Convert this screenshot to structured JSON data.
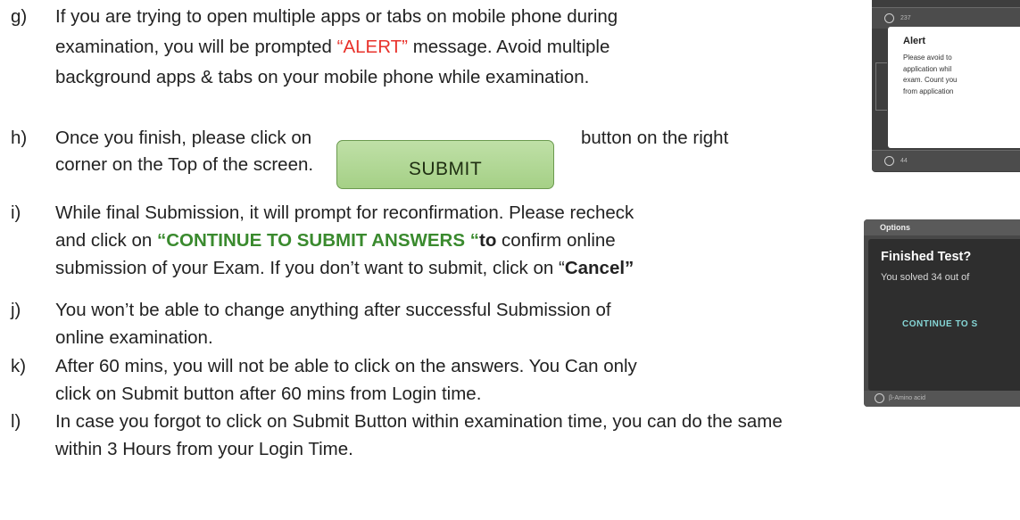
{
  "instructions": [
    {
      "letter": "g)",
      "lines": [
        [
          "If you are trying to open multiple apps or tabs on mobile phone during"
        ],
        [
          "examination, you will be prompted ",
          {
            "alert": "“ALERT”"
          },
          " message. Avoid multiple"
        ],
        [
          "background apps & tabs on your mobile phone while examination."
        ]
      ]
    },
    {
      "letter": "h)",
      "lines": [
        [
          "Once you finish, please click on"
        ],
        [
          "corner on the Top of the screen."
        ]
      ],
      "after_button": "button on the right"
    },
    {
      "letter": "i)",
      "lines": [
        [
          "While final Submission, it will prompt for reconfirmation. Please recheck"
        ],
        [
          "and click on ",
          {
            "green": "“CONTINUE TO SUBMIT ANSWERS “"
          },
          {
            "greenbold": "to"
          },
          " confirm online"
        ],
        [
          "submission of your Exam.  If you don’t want to submit, click on “",
          {
            "bold": "Cancel”"
          }
        ]
      ]
    },
    {
      "letter": "j)",
      "lines": [
        [
          "You won’t be able to change anything after successful Submission of"
        ],
        [
          "online examination."
        ]
      ]
    },
    {
      "letter": "k)",
      "lines": [
        [
          "After 60 mins, you will not be able to click on the answers. You Can only"
        ],
        [
          "click on Submit button after 60 mins from Login time."
        ]
      ]
    },
    {
      "letter": "l)",
      "lines": [
        [
          "In case you forgot to click on Submit Button within examination time, you can do the same"
        ],
        [
          "within 3 Hours from your Login Time."
        ]
      ]
    }
  ],
  "submit_button": {
    "label": "SUBMIT"
  },
  "screenshot_alert": {
    "top_option": "237",
    "bottom_option": "44",
    "title": "Alert",
    "body": "Please avoid to\napplication whil\nexam. Count you\nfrom application"
  },
  "screenshot_finish": {
    "header": "Options",
    "title": "Finished Test?",
    "message": "You solved 34 out of",
    "continue_label": "CONTINUE TO S",
    "bottom_option": "β-Amino acid"
  },
  "colors": {
    "alert": "#e8322b",
    "green": "#3a8a2e",
    "submit_fill": "#a5d086",
    "continue_text": "#86d6d6"
  }
}
